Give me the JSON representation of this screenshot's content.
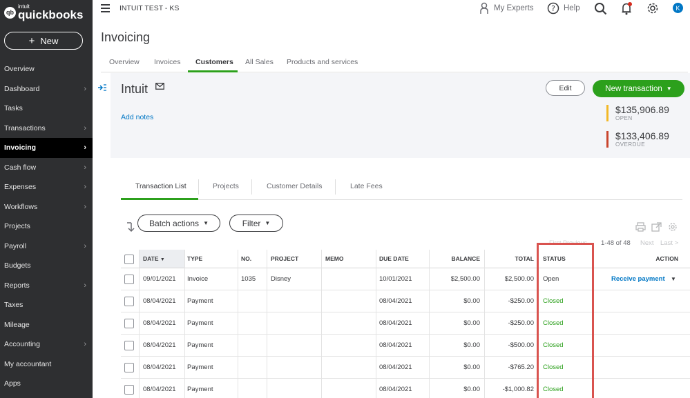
{
  "sidebar": {
    "logo_brand": "intuit",
    "logo_product": "quickbooks",
    "logo_mark": "qb",
    "new_label": "New",
    "items": [
      {
        "label": "Overview",
        "chevron": false
      },
      {
        "label": "Dashboard",
        "chevron": true
      },
      {
        "label": "Tasks",
        "chevron": false
      },
      {
        "label": "Transactions",
        "chevron": true
      },
      {
        "label": "Invoicing",
        "chevron": true,
        "active": true
      },
      {
        "label": "Cash flow",
        "chevron": true
      },
      {
        "label": "Expenses",
        "chevron": true
      },
      {
        "label": "Workflows",
        "chevron": true
      },
      {
        "label": "Projects",
        "chevron": false
      },
      {
        "label": "Payroll",
        "chevron": true
      },
      {
        "label": "Budgets",
        "chevron": false
      },
      {
        "label": "Reports",
        "chevron": true
      },
      {
        "label": "Taxes",
        "chevron": false
      },
      {
        "label": "Mileage",
        "chevron": false
      },
      {
        "label": "Accounting",
        "chevron": true
      },
      {
        "label": "My accountant",
        "chevron": false
      },
      {
        "label": "Apps",
        "chevron": false
      }
    ]
  },
  "topbar": {
    "company": "INTUIT TEST - KS",
    "my_experts": "My Experts",
    "help": "Help",
    "avatar": "K"
  },
  "page": {
    "title": "Invoicing",
    "tabs": [
      "Overview",
      "Invoices",
      "Customers",
      "All Sales",
      "Products and services"
    ],
    "active_tab": "Customers"
  },
  "customer": {
    "name": "Intuit",
    "add_notes": "Add notes",
    "edit": "Edit",
    "new_transaction": "New transaction",
    "open_amount": "$135,906.89",
    "open_label": "OPEN",
    "overdue_amount": "$133,406.89",
    "overdue_label": "OVERDUE"
  },
  "subtabs": [
    "Transaction List",
    "Projects",
    "Customer Details",
    "Late Fees"
  ],
  "toolbar": {
    "batch_actions": "Batch actions",
    "filter": "Filter",
    "faded_text": "First Previous",
    "pager_range": "1-48 of 48",
    "pager_next": "Next",
    "pager_last": "Last >"
  },
  "table": {
    "headers": {
      "date": "DATE",
      "type": "TYPE",
      "no": "NO.",
      "project": "PROJECT",
      "memo": "MEMO",
      "due_date": "DUE DATE",
      "balance": "BALANCE",
      "total": "TOTAL",
      "status": "STATUS",
      "action": "ACTION"
    },
    "rows": [
      {
        "date": "09/01/2021",
        "type": "Invoice",
        "no": "1035",
        "project": "Disney",
        "memo": "",
        "due_date": "10/01/2021",
        "balance": "$2,500.00",
        "total": "$2,500.00",
        "status": "Open",
        "action": "Receive payment"
      },
      {
        "date": "08/04/2021",
        "type": "Payment",
        "no": "",
        "project": "",
        "memo": "",
        "due_date": "08/04/2021",
        "balance": "$0.00",
        "total": "-$250.00",
        "status": "Closed",
        "action": ""
      },
      {
        "date": "08/04/2021",
        "type": "Payment",
        "no": "",
        "project": "",
        "memo": "",
        "due_date": "08/04/2021",
        "balance": "$0.00",
        "total": "-$250.00",
        "status": "Closed",
        "action": ""
      },
      {
        "date": "08/04/2021",
        "type": "Payment",
        "no": "",
        "project": "",
        "memo": "",
        "due_date": "08/04/2021",
        "balance": "$0.00",
        "total": "-$500.00",
        "status": "Closed",
        "action": ""
      },
      {
        "date": "08/04/2021",
        "type": "Payment",
        "no": "",
        "project": "",
        "memo": "",
        "due_date": "08/04/2021",
        "balance": "$0.00",
        "total": "-$765.20",
        "status": "Closed",
        "action": ""
      },
      {
        "date": "08/04/2021",
        "type": "Payment",
        "no": "",
        "project": "",
        "memo": "",
        "due_date": "08/04/2021",
        "balance": "$0.00",
        "total": "-$1,000.82",
        "status": "Closed",
        "action": ""
      }
    ]
  },
  "colors": {
    "sidebar_bg": "#2e2f31",
    "green": "#2ca01c",
    "blue_link": "#0077c5",
    "open_bar": "#f2b827",
    "overdue_bar": "#c9452d",
    "highlight": "#d9534f"
  }
}
